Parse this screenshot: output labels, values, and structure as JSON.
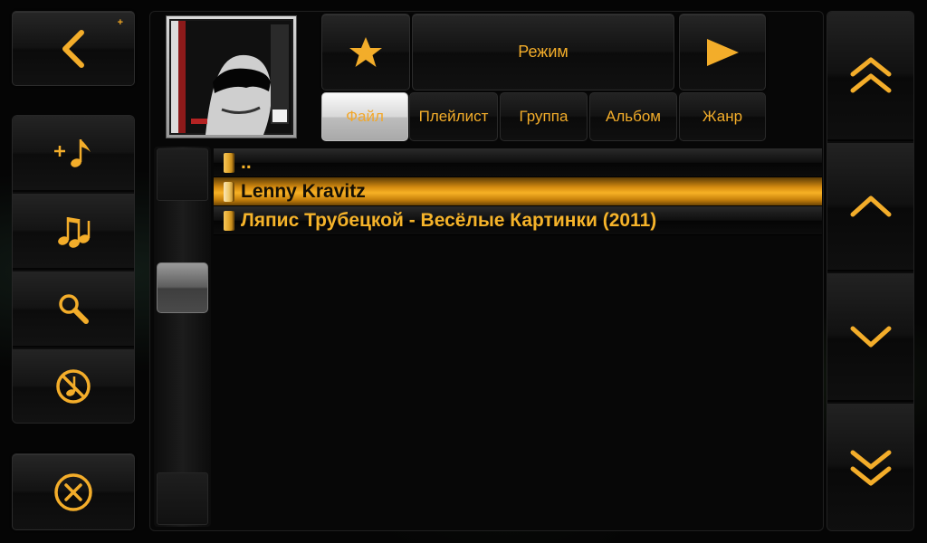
{
  "colors": {
    "accent": "#f3ad2a",
    "selected_row": "#f7b125",
    "background": "#050505"
  },
  "left_panel": {
    "back_button": {
      "icon": "chevron-left-icon",
      "badge": "+"
    },
    "actions": [
      {
        "name": "add-track",
        "icon": "plus-note-icon"
      },
      {
        "name": "notes",
        "icon": "notes-icon"
      },
      {
        "name": "search",
        "icon": "search-icon"
      },
      {
        "name": "no-music",
        "icon": "no-music-icon"
      }
    ],
    "close_button": {
      "icon": "close-circle-icon"
    }
  },
  "header": {
    "favorite_icon": "star-icon",
    "mode_label": "Режим",
    "play_icon": "play-icon"
  },
  "tabs": [
    {
      "label": "Файл",
      "active": true
    },
    {
      "label": "Плейлист",
      "active": false
    },
    {
      "label": "Группа",
      "active": false
    },
    {
      "label": "Альбом",
      "active": false
    },
    {
      "label": "Жанр",
      "active": false
    }
  ],
  "file_list": [
    {
      "label": "..",
      "selected": false
    },
    {
      "label": "Lenny Kravitz",
      "selected": true
    },
    {
      "label": "Ляпис Трубецкой - Весёлые Картинки (2011)",
      "selected": false
    }
  ],
  "scroll": {
    "position": 0.35
  },
  "right_panel": [
    {
      "name": "page-up",
      "icon": "double-chevron-up-icon"
    },
    {
      "name": "line-up",
      "icon": "chevron-up-icon"
    },
    {
      "name": "line-down",
      "icon": "chevron-down-icon"
    },
    {
      "name": "page-down",
      "icon": "double-chevron-down-icon"
    }
  ]
}
